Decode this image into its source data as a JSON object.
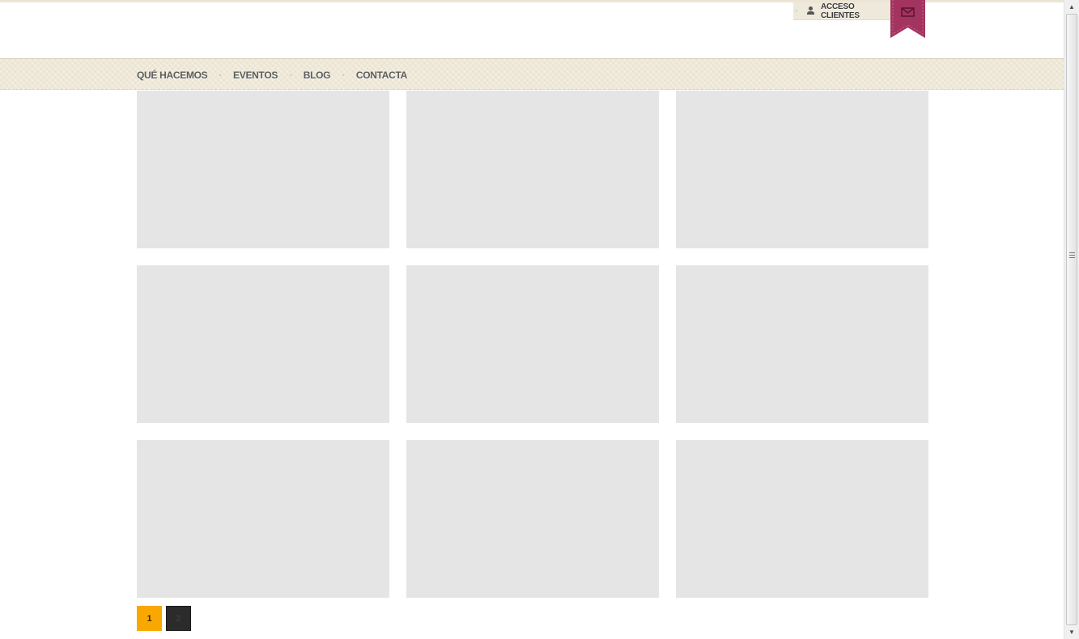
{
  "header": {
    "client_access_label": "ACCESO CLIENTES",
    "user_icon": "user-icon",
    "mail_icon": "envelope-icon",
    "ribbon_color": "#a3345f"
  },
  "nav": {
    "items": [
      {
        "label": "QUÉ HACEMOS"
      },
      {
        "label": "EVENTOS"
      },
      {
        "label": "BLOG"
      },
      {
        "label": "CONTACTA"
      }
    ],
    "separator": "·"
  },
  "grid": {
    "tiles_count": 9,
    "placeholder_color": "#e5e5e5"
  },
  "pagination": {
    "pages": [
      "1",
      "2"
    ],
    "current": "1",
    "active_color": "#f8a800",
    "inactive_color": "#2b2b2b"
  },
  "scrollbar": {
    "up_icon": "arrow-up-icon",
    "down_icon": "arrow-down-icon"
  }
}
